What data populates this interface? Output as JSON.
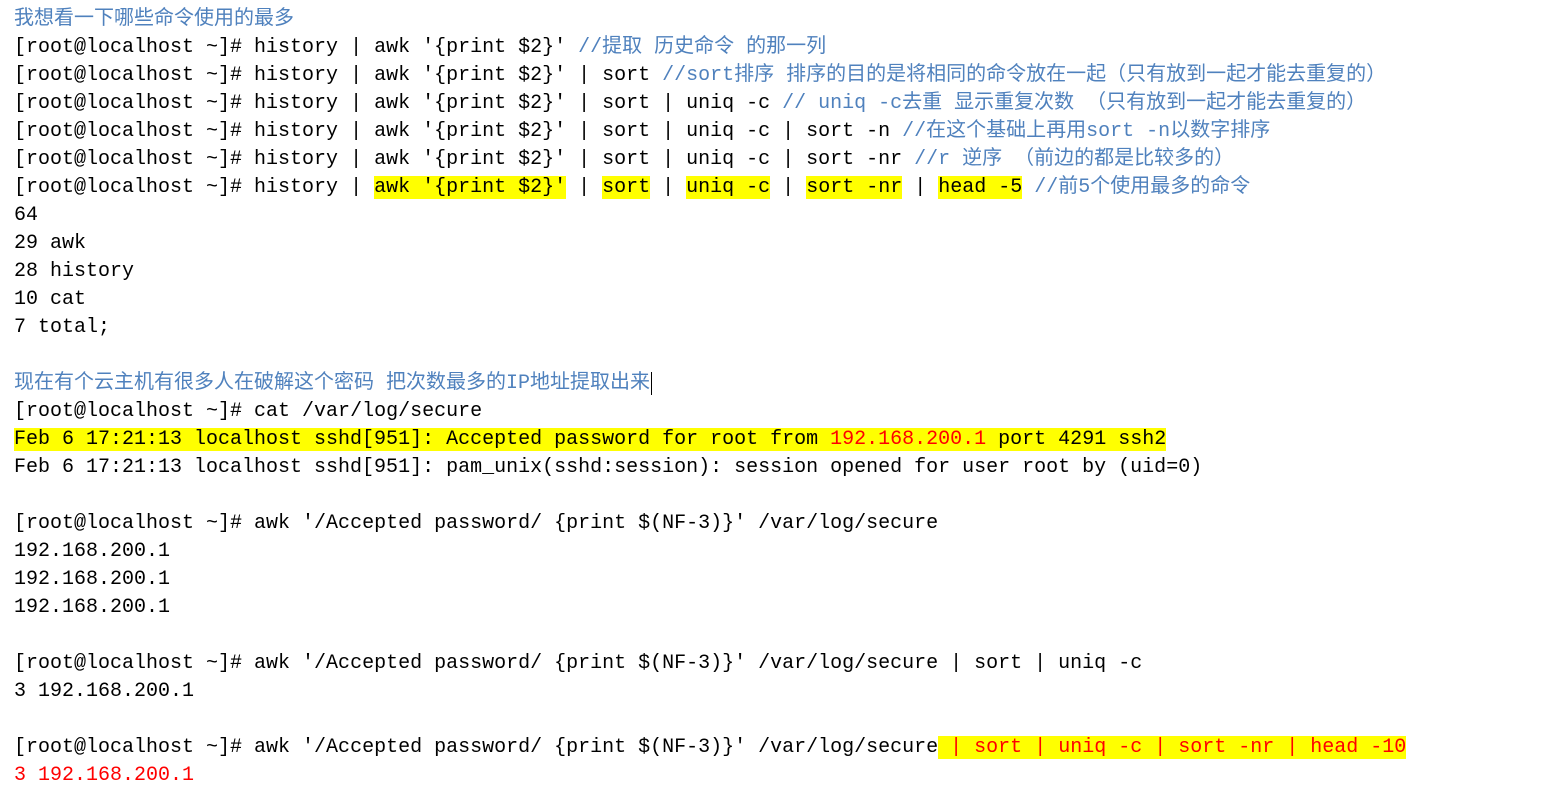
{
  "heading1": "我想看一下哪些命令使用的最多",
  "prompt": "[root@localhost ~]# ",
  "l1_cmd": "history | awk '{print $2}'",
  "l1_gap": "      ",
  "l1_c": "//提取  历史命令   的那一列",
  "l2_cmd": "history | awk '{print $2}' | sort",
  "l2_gap": "      ",
  "l2_c": "//sort排序    排序的目的是将相同的命令放在一起（只有放到一起才能去重复的）",
  "l3_cmd": "history | awk '{print $2}' | sort | uniq -c",
  "l3_gap": "         ",
  "l3_c": "// uniq -c去重   显示重复次数     （只有放到一起才能去重复的）",
  "l4_cmd": "history | awk '{print $2}' | sort | uniq -c | sort -n",
  "l4_gap": "     ",
  "l4_c": "//在这个基础上再用sort -n以数字排序",
  "l5_cmd": "history | awk '{print $2}' | sort | uniq -c | sort -nr",
  "l5_gap": "     ",
  "l5_c": "//r  逆序  （前边的都是比较多的）",
  "l6a": "history | ",
  "l6h1": "awk '{print $2}'",
  "l6p1": " | ",
  "l6h2": "sort",
  "l6p2": " | ",
  "l6h3": "uniq -c",
  "l6p3": " | ",
  "l6h4": "sort -nr",
  "l6p4": " | ",
  "l6h5": "head -5",
  "l6_gap": "       ",
  "l6_c": "//前5个使用最多的命令",
  "out1": "     64 ",
  "out2": "     29 awk",
  "out3": "     28 history",
  "out4": "     10 cat",
  "out5": "      7 total;",
  "heading2a": "现在有个云主机有很多人在破解这个密码   把次数最多的IP地址提取出来",
  "catcmd": "cat /var/log/secure",
  "log1a": "Feb  6 17:21:13 localhost sshd[951]: Accepted password for root from ",
  "log1ip": "192.168.200.1",
  "log1b": " port 4291 ssh2",
  "log2": "Feb  6 17:21:13 localhost sshd[951]: pam_unix(sshd:session): session opened for user root by (uid=0)",
  "awkcmd1": "awk '/Accepted password/ {print $(NF-3)}' /var/log/secure",
  "ip1": "192.168.200.1",
  "ip2": "192.168.200.1",
  "ip3": "192.168.200.1",
  "awkcmd2": "awk '/Accepted password/ {print $(NF-3)}' /var/log/secure | sort | uniq -c",
  "uniqout": "      3 192.168.200.1",
  "awkcmd3a": "awk '/Accepted password/ {print $(NF-3)}' /var/log/secure",
  "awkcmd3_hl": " | sort | uniq -c | sort -nr | head -10",
  "final_pre": "      ",
  "final_red": "3 192.168.200.1"
}
